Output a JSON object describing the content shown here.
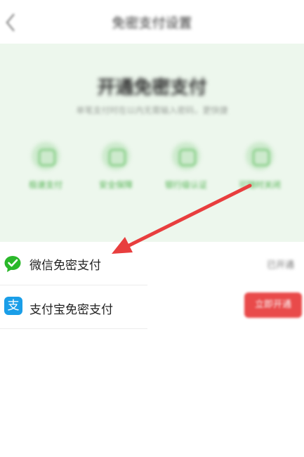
{
  "header": {
    "title": "免密支付设置"
  },
  "hero": {
    "title": "开通免密支付",
    "subtitle": "单笔支付时在以内无需输入密码，更快捷",
    "features": [
      {
        "label": "极速支付",
        "icon": "speed-icon"
      },
      {
        "label": "安全保障",
        "icon": "shield-icon"
      },
      {
        "label": "银行级认证",
        "icon": "bank-icon"
      },
      {
        "label": "可随时关闭",
        "icon": "toggle-icon"
      }
    ]
  },
  "payment_methods": [
    {
      "label": "微信免密支付",
      "icon": "wechat-icon",
      "status": "已开通"
    },
    {
      "label": "支付宝免密支付",
      "icon": "alipay-icon",
      "action": "立即开通"
    }
  ],
  "icons": {
    "alipay_glyph": "支"
  },
  "colors": {
    "hero_bg": "#edf7ed",
    "accent_green": "#4fb24f",
    "wechat_green": "#2ab82a",
    "alipay_blue": "#1a9ee8",
    "open_button_red": "#e94a4a",
    "annotation_arrow": "#e83e3e"
  }
}
